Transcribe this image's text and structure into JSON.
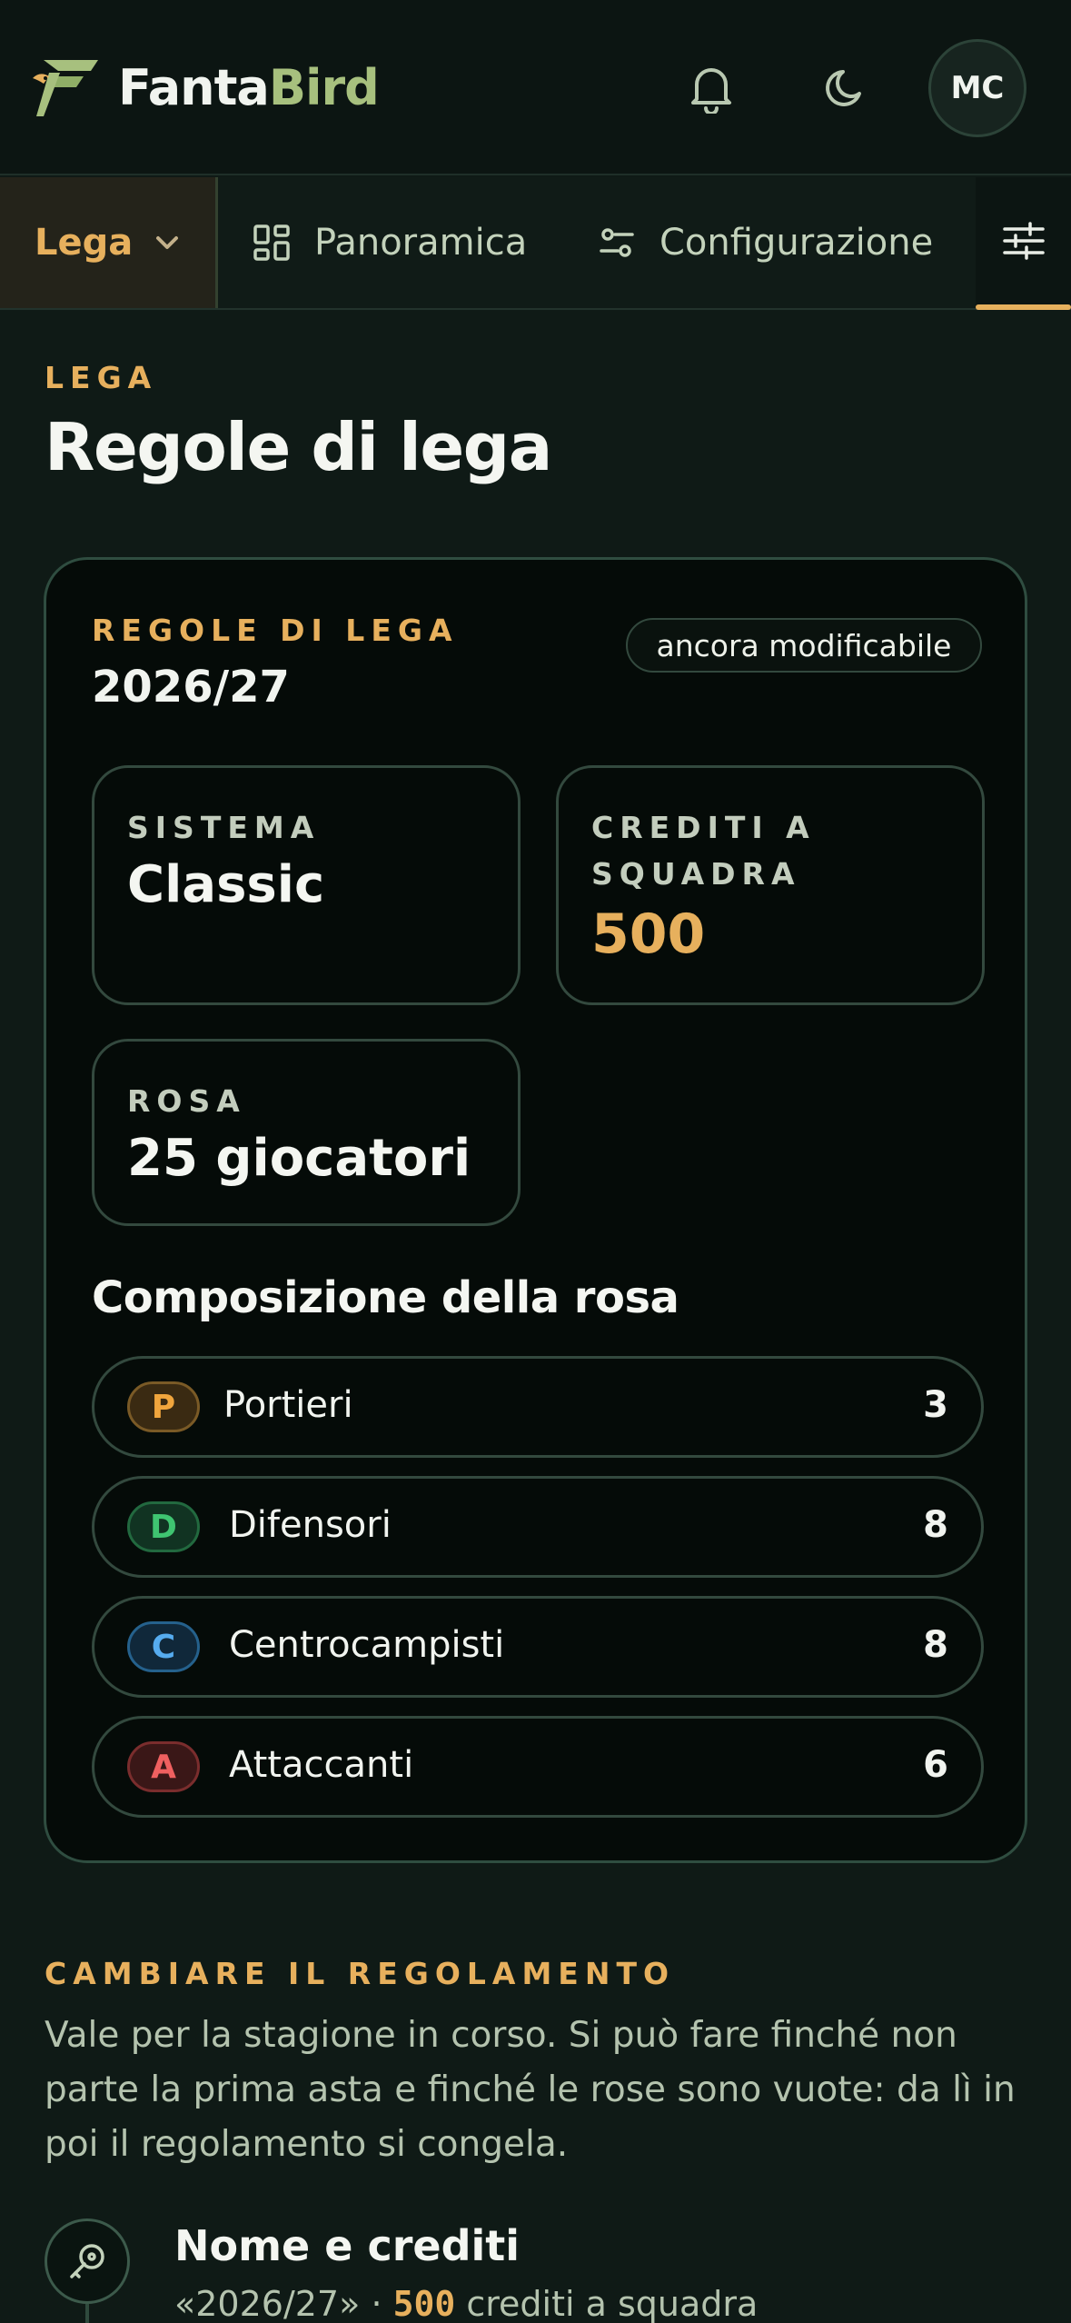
{
  "header": {
    "logo_text_a": "Fanta",
    "logo_text_b": "Bird",
    "avatar_initials": "MC"
  },
  "tabs": {
    "lega_label": "Lega",
    "items": [
      {
        "label": "Panoramica"
      },
      {
        "label": "Configurazione"
      }
    ]
  },
  "page": {
    "eyebrow": "LEGA",
    "title": "Regole di lega"
  },
  "card": {
    "eyebrow": "REGOLE DI LEGA",
    "season": "2026/27",
    "status": "ancora modificabile",
    "stats": {
      "sistema_label": "SISTEMA",
      "sistema_value": "Classic",
      "crediti_label": "CREDITI A SQUADRA",
      "crediti_value": "500",
      "rosa_label": "ROSA",
      "rosa_value": "25 giocatori"
    },
    "composition_title": "Composizione della rosa",
    "roles": [
      {
        "badge": "P",
        "name": "Portieri",
        "count": "3"
      },
      {
        "badge": "D",
        "name": "Difensori",
        "count": "8"
      },
      {
        "badge": "C",
        "name": "Centrocampisti",
        "count": "8"
      },
      {
        "badge": "A",
        "name": "Attaccanti",
        "count": "6"
      }
    ]
  },
  "rules": {
    "eyebrow": "CAMBIARE IL REGOLAMENTO",
    "text": "Vale per la stagione in corso. Si può fare finché non parte la prima asta e finché le rose sono vuote: da lì in poi il regolamento si congela.",
    "step": {
      "title": "Nome e crediti",
      "sub_prefix": "«2026/27» · ",
      "sub_value": "500",
      "sub_suffix": " crediti a squadra"
    }
  },
  "colors": {
    "accent": "#e7b05d",
    "brand_green": "#a7c07e",
    "background": "#0f1a16",
    "card": "#050b08"
  }
}
